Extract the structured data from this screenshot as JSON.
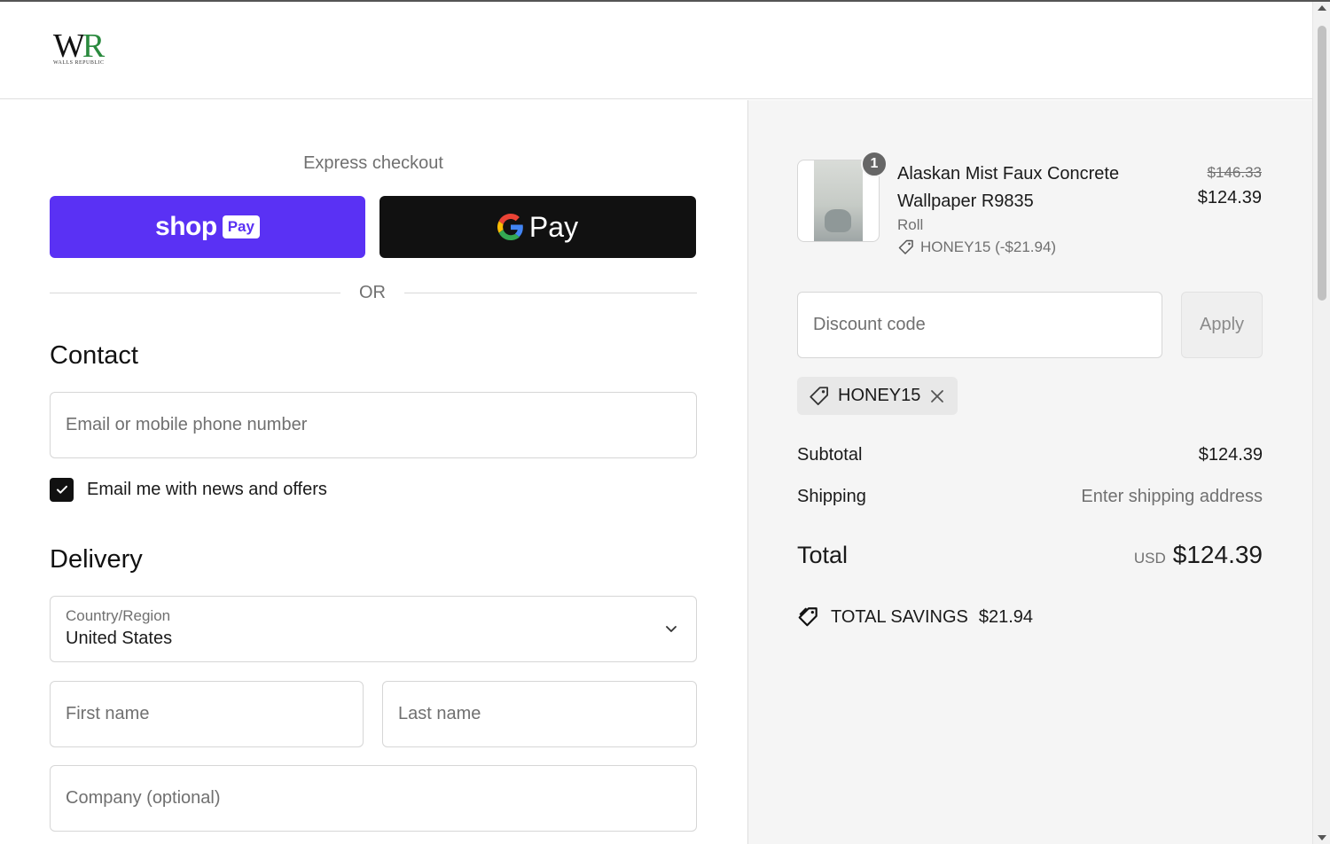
{
  "header": {
    "logo_mark_w": "W",
    "logo_mark_r": "R",
    "logo_subtitle": "WALLS REPUBLIC"
  },
  "checkout": {
    "express_title": "Express checkout",
    "shop_pay_word": "shop",
    "shop_pay_badge": "Pay",
    "gpay_label": "Pay",
    "or_text": "OR",
    "contact_title": "Contact",
    "email_placeholder": "Email or mobile phone number",
    "email_value": "",
    "newsletter_checked": true,
    "newsletter_label": "Email me with news and offers",
    "delivery_title": "Delivery",
    "country_label": "Country/Region",
    "country_value": "United States",
    "first_name_placeholder": "First name",
    "last_name_placeholder": "Last name",
    "company_placeholder": "Company (optional)"
  },
  "summary": {
    "item": {
      "quantity": "1",
      "name": "Alaskan Mist Faux Concrete Wallpaper R9835",
      "variant": "Roll",
      "discount_line": "HONEY15 (-$21.94)",
      "price_original": "$146.33",
      "price_current": "$124.39"
    },
    "discount_placeholder": "Discount code",
    "apply_label": "Apply",
    "applied_code": "HONEY15",
    "subtotal_label": "Subtotal",
    "subtotal_value": "$124.39",
    "shipping_label": "Shipping",
    "shipping_value": "Enter shipping address",
    "total_label": "Total",
    "total_currency": "USD",
    "total_value": "$124.39",
    "savings_label": "TOTAL SAVINGS",
    "savings_value": "$21.94"
  },
  "colors": {
    "shop_pay": "#5a31f4",
    "gpay_bg": "#111111",
    "logo_accent": "#2a8a3e"
  }
}
